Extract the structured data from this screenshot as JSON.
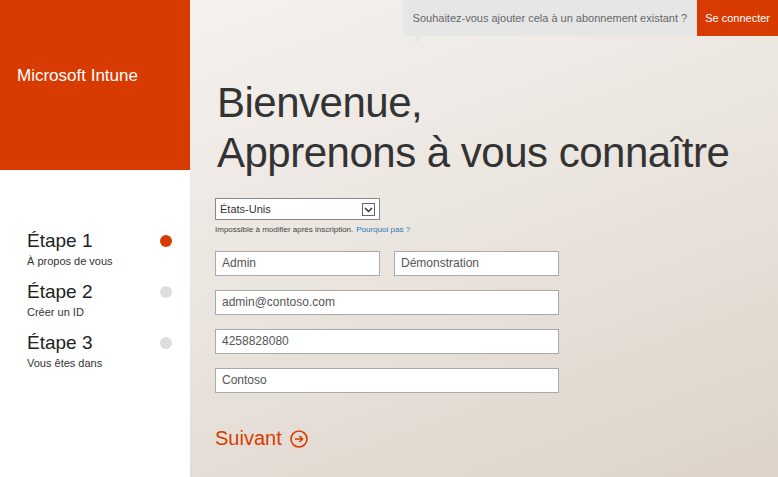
{
  "sidebar": {
    "brand": "Microsoft Intune",
    "steps": [
      {
        "label": "Étape 1",
        "caption": "À propos de vous",
        "selected": true
      },
      {
        "label": "Étape 2",
        "caption": "Créer un ID",
        "selected": false
      },
      {
        "label": "Étape 3",
        "caption": "Vous êtes dans",
        "selected": false
      }
    ]
  },
  "topbar": {
    "prompt": "Souhaitez-vous ajouter cela à un abonnement existant ?",
    "signin": "Se connecter"
  },
  "heading": [
    "Bienvenue,",
    "Apprenons à vous connaître"
  ],
  "form": {
    "country": "États-Unis",
    "note": "Impossible à modifier après inscription.",
    "note_link": "Pourquoi pas ?",
    "first_name": "Admin",
    "last_name": "Démonstration",
    "email": "admin@contoso.com",
    "phone": "4258828080",
    "company": "Contoso"
  },
  "next": {
    "label": "Suivant"
  }
}
